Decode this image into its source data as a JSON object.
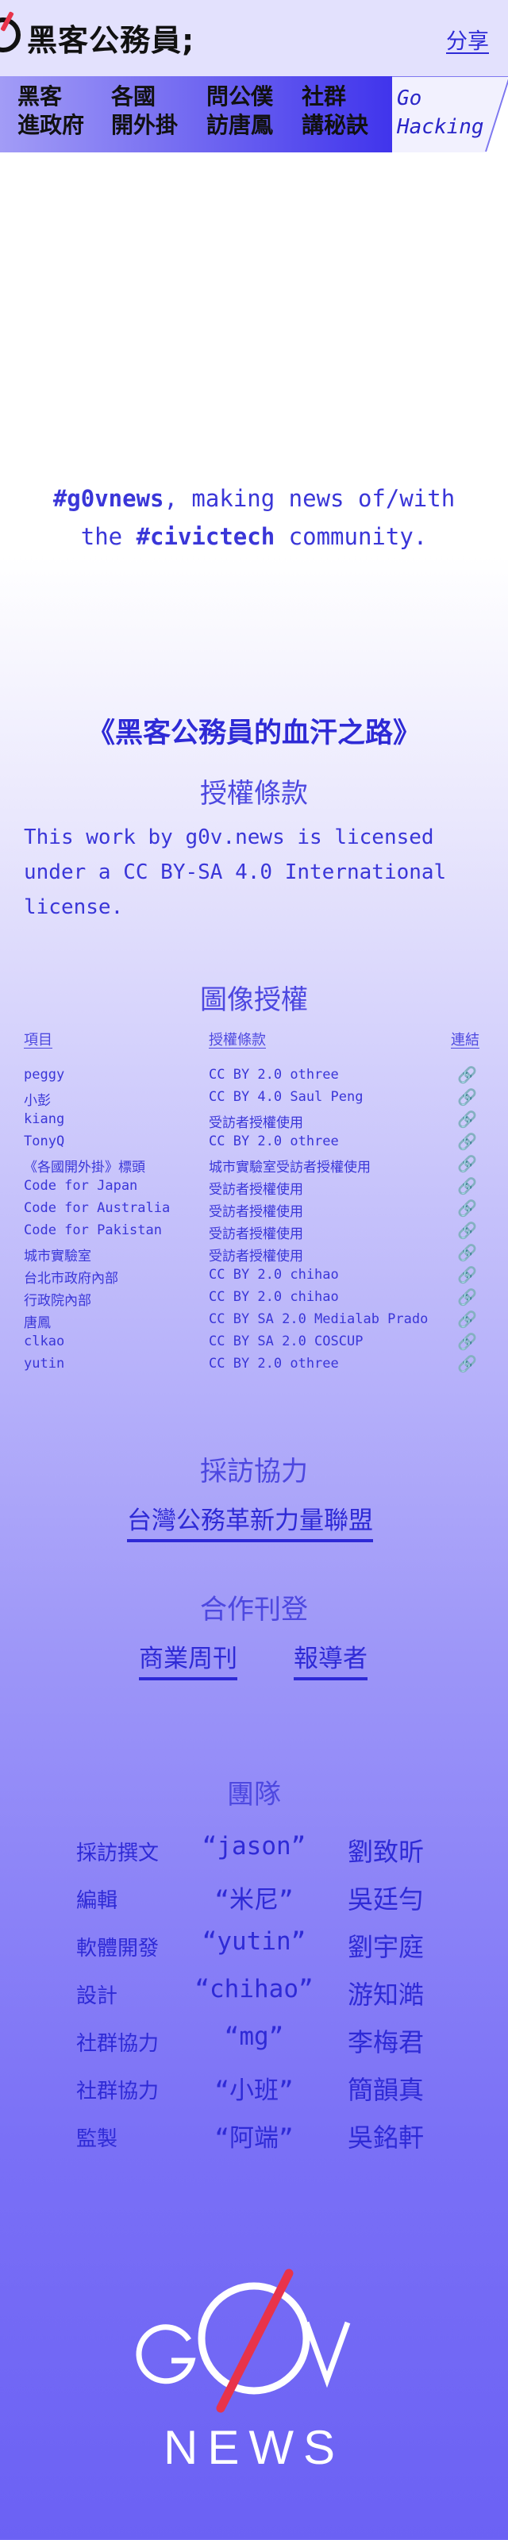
{
  "header": {
    "site_title": "黑客公務員;",
    "share_label": "分享",
    "nav": [
      {
        "line1": "黑客",
        "line2": "進政府"
      },
      {
        "line1": "各國",
        "line2": "開外掛"
      },
      {
        "line1": "問公僕",
        "line2": "訪唐鳳"
      },
      {
        "line1": "社群",
        "line2": "講秘訣"
      }
    ],
    "go_hacking": {
      "line1": "Go",
      "line2": "Hacking"
    }
  },
  "tagline": {
    "hashtag1": "#g0vnews",
    "text1": ", making news of/with",
    "text2": "the ",
    "hashtag2": "#civictech",
    "text3": " community."
  },
  "book_title": "《黑客公務員的血汗之路》",
  "license_section": {
    "heading": "授權條款",
    "text": "This work by g0v.news is licensed under a CC BY-SA 4.0 International license."
  },
  "image_credits": {
    "heading": "圖像授權",
    "columns": [
      "項目",
      "授權條款",
      "連結"
    ],
    "rows": [
      {
        "item": "peggy",
        "license": "CC BY 2.0 othree"
      },
      {
        "item": "小彭",
        "license": "CC BY 4.0 Saul Peng"
      },
      {
        "item": "kiang",
        "license": "受訪者授權使用"
      },
      {
        "item": "TonyQ",
        "license": "CC BY 2.0 othree"
      },
      {
        "item": "《各國開外掛》標頭",
        "license": "城市實驗室受訪者授權使用"
      },
      {
        "item": "Code for Japan",
        "license": "受訪者授權使用"
      },
      {
        "item": "Code for Australia",
        "license": "受訪者授權使用"
      },
      {
        "item": "Code for Pakistan",
        "license": "受訪者授權使用"
      },
      {
        "item": "城市實驗室",
        "license": "受訪者授權使用"
      },
      {
        "item": "台北市政府內部",
        "license": "CC BY 2.0 chihao"
      },
      {
        "item": "行政院內部",
        "license": "CC BY 2.0 chihao"
      },
      {
        "item": "唐鳳",
        "license": "CC BY SA 2.0 Medialab Prado"
      },
      {
        "item": "clkao",
        "license": "CC BY SA 2.0 COSCUP"
      },
      {
        "item": "yutin",
        "license": "CC BY 2.0 othree"
      }
    ],
    "link_icon": "link-icon"
  },
  "interview_partner": {
    "heading": "採訪協力",
    "link": "台灣公務革新力量聯盟"
  },
  "copublish": {
    "heading": "合作刊登",
    "links": [
      "商業周刊",
      "報導者"
    ]
  },
  "team": {
    "heading": "團隊",
    "members": [
      {
        "role": "採訪撰文",
        "nick": "“jason”",
        "name": "劉致昕"
      },
      {
        "role": "編輯",
        "nick": "“米尼”",
        "name": "吳廷勻"
      },
      {
        "role": "軟體開發",
        "nick": "“yutin”",
        "name": "劉宇庭"
      },
      {
        "role": "設計",
        "nick": "“chihao”",
        "name": "游知澔"
      },
      {
        "role": "社群協力",
        "nick": "“mg”",
        "name": "李梅君"
      },
      {
        "role": "社群協力",
        "nick": "“小班”",
        "name": "簡韻真"
      },
      {
        "role": "監製",
        "nick": "“阿端”",
        "name": "吳銘軒"
      }
    ]
  },
  "footer_logo": {
    "line1": "G0V",
    "line2": "NEWS"
  },
  "colors": {
    "accent": "#2e2ad6",
    "brand_red": "#e8334a",
    "nav_start": "#a29cf6",
    "nav_end": "#3f33ec"
  }
}
